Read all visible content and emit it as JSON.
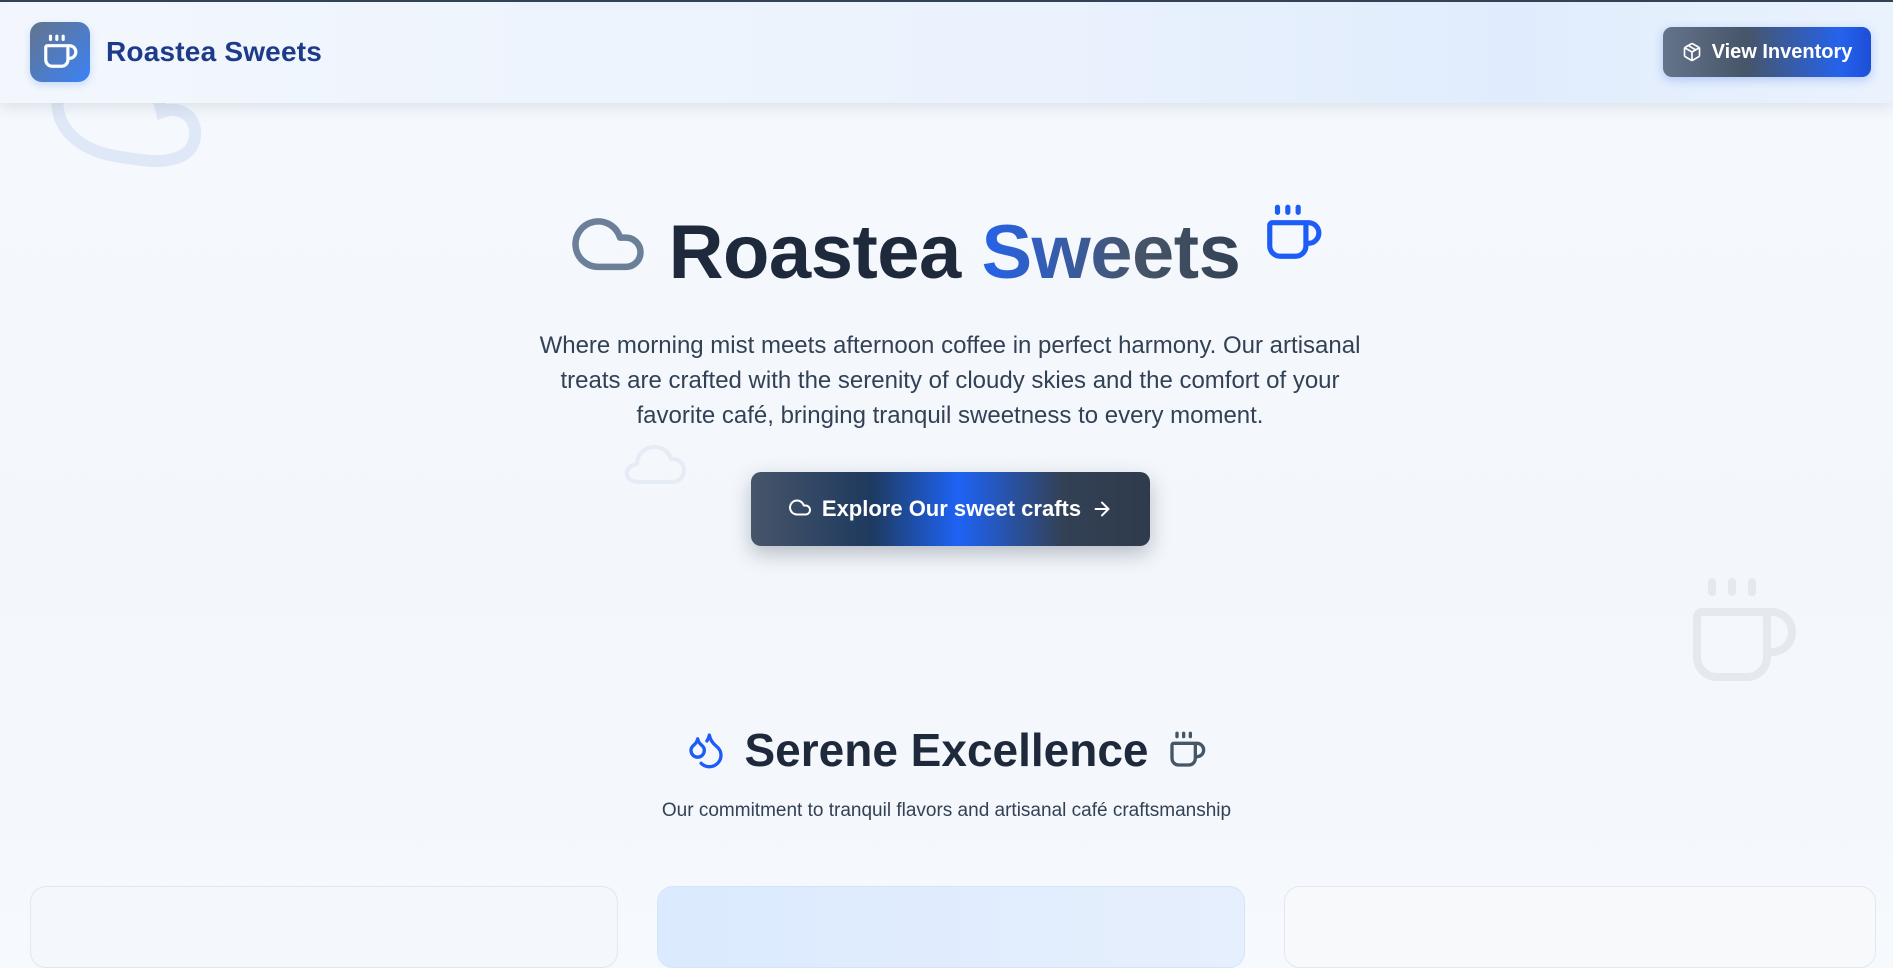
{
  "header": {
    "brand": "Roastea Sweets",
    "inventory_button": "View Inventory"
  },
  "hero": {
    "title_part1": "Roastea",
    "title_part2": "Sweets",
    "description": "Where morning mist meets afternoon coffee in perfect harmony. Our artisanal treats are crafted with the serenity of cloudy skies and the comfort of your favorite café, bringing tranquil sweetness to every moment.",
    "cta_label": "Explore Our sweet crafts"
  },
  "section": {
    "title": "Serene Excellence",
    "subtitle": "Our commitment to tranquil flavors and artisanal café craftsmanship"
  },
  "icons": {
    "logo": "coffee-cup-icon",
    "inventory": "package-icon",
    "hero_left": "cloud-icon",
    "hero_right": "coffee-cup-icon",
    "cta_left": "cloud-icon",
    "cta_right": "arrow-right-icon",
    "section_left": "droplets-icon",
    "section_right": "coffee-cup-icon"
  },
  "colors": {
    "brand_dark": "#1e293b",
    "brand_blue": "#2563eb",
    "brand_navy": "#1e3a8a",
    "slate": "#64748b"
  }
}
